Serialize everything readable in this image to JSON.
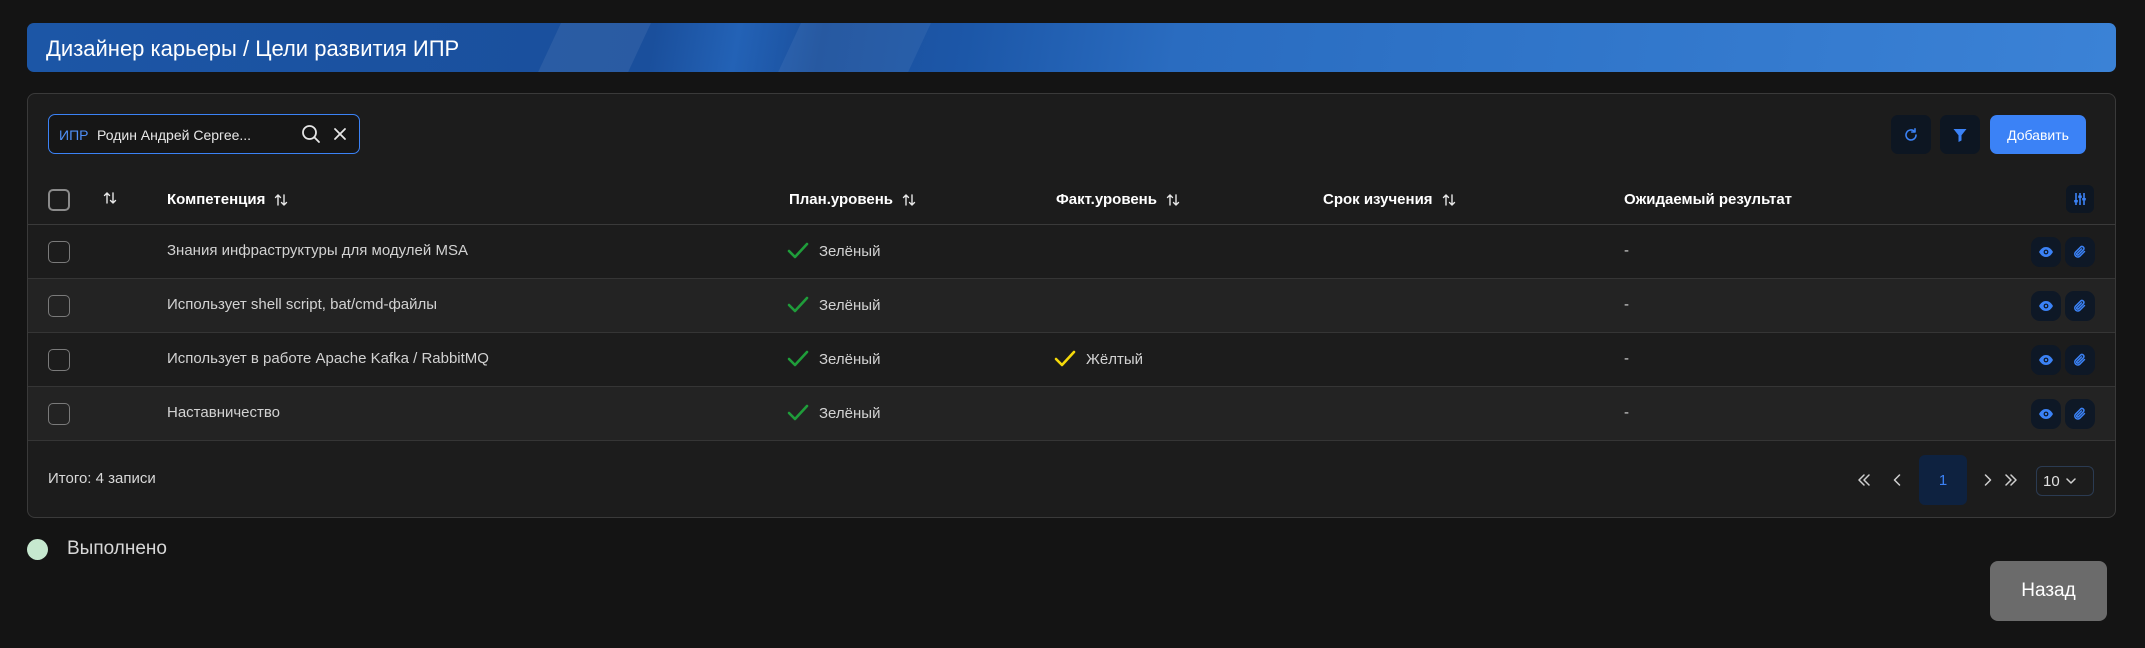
{
  "header": {
    "title": "Дизайнер карьеры / Цели развития ИПР"
  },
  "search": {
    "prefix": "ИПР",
    "value": "Родин Андрей Сергее..."
  },
  "toolbar": {
    "add_label": "Добавить"
  },
  "table": {
    "columns": [
      "Компетенция",
      "План.уровень",
      "Факт.уровень",
      "Срок изучения",
      "Ожидаемый результат"
    ],
    "rows": [
      {
        "competence": "Знания инфраструктуры для модулей MSA",
        "plan": "Зелёный",
        "fact": "",
        "term": "",
        "result": "-"
      },
      {
        "competence": "Использует shell script, bat/cmd-файлы",
        "plan": "Зелёный",
        "fact": "",
        "term": "",
        "result": "-"
      },
      {
        "competence": "Использует в работе Apache Kafka / RabbitMQ",
        "plan": "Зелёный",
        "fact": "Жёлтый",
        "term": "",
        "result": "-"
      },
      {
        "competence": "Наставничество",
        "plan": "Зелёный",
        "fact": "",
        "term": "",
        "result": "-"
      }
    ]
  },
  "footer": {
    "total": "Итого: 4 записи",
    "current_page": "1",
    "per_page": "10"
  },
  "legend": {
    "done_label": "Выполнено",
    "done_color": "#c6e8cf"
  },
  "back_label": "Назад",
  "colors": {
    "accent": "#3b82f6",
    "green": "#1f9d3a",
    "yellow": "#f5d90a"
  },
  "icons": [
    "search-icon",
    "close-icon",
    "refresh-icon",
    "filter-icon",
    "sort-icon",
    "columns-settings-icon",
    "eye-icon",
    "paperclip-icon",
    "check-icon",
    "chevrons-left-icon",
    "chevron-left-icon",
    "chevron-right-icon",
    "chevrons-right-icon",
    "chevron-down-icon"
  ]
}
